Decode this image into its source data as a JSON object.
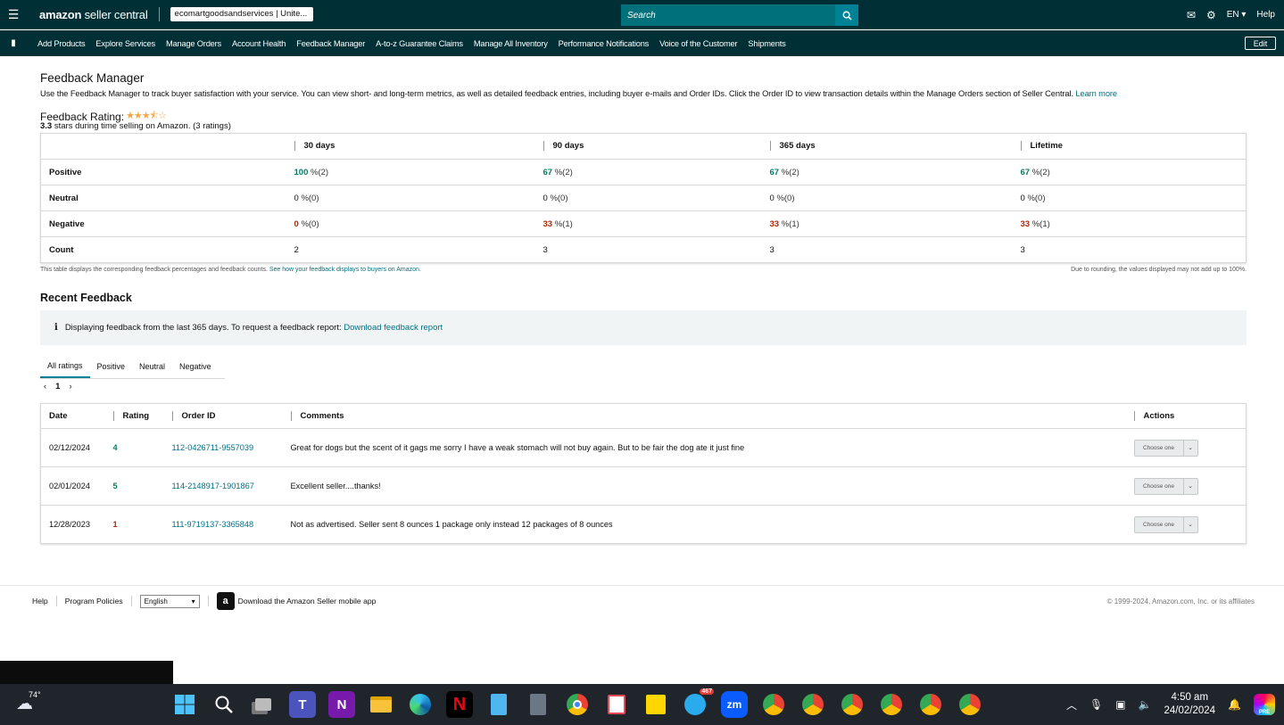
{
  "topbar": {
    "logo_brand": "amazon",
    "logo_suffix": "seller central",
    "store": "ecomartgoodsandservices | Unite...",
    "search_placeholder": "Search",
    "language": "EN",
    "help": "Help"
  },
  "nav": {
    "items": [
      "Add Products",
      "Explore Services",
      "Manage Orders",
      "Account Health",
      "Feedback Manager",
      "A-to-z Guarantee Claims",
      "Manage All Inventory",
      "Performance Notifications",
      "Voice of the Customer",
      "Shipments"
    ],
    "edit": "Edit"
  },
  "page": {
    "title": "Feedback Manager",
    "intro": "Use the Feedback Manager to track buyer satisfaction with your service. You can view short- and long-term metrics, as well as detailed feedback entries, including buyer e-mails and Order IDs. Click the Order ID to view transaction details within the Manage Orders section of Seller Central.",
    "learn_more": "Learn more",
    "rating_label": "Feedback Rating:",
    "rating_value": 3.3,
    "rating_stars": "3.3",
    "rating_sub_text": "stars during time selling on Amazon. (3 ratings)"
  },
  "metrics": {
    "columns": [
      "30 days",
      "90 days",
      "365 days",
      "Lifetime"
    ],
    "rows": [
      {
        "label": "Positive",
        "cells": [
          {
            "v": "100",
            "s": "%(2)"
          },
          {
            "v": "67",
            "s": "%(2)"
          },
          {
            "v": "67",
            "s": "%(2)"
          },
          {
            "v": "67",
            "s": "%(2)"
          }
        ]
      },
      {
        "label": "Neutral",
        "cells": [
          {
            "v": "0",
            "s": "%(0)"
          },
          {
            "v": "0",
            "s": "%(0)"
          },
          {
            "v": "0",
            "s": "%(0)"
          },
          {
            "v": "0",
            "s": "%(0)"
          }
        ]
      },
      {
        "label": "Negative",
        "cells": [
          {
            "v": "0",
            "s": "%(0)"
          },
          {
            "v": "33",
            "s": "%(1)"
          },
          {
            "v": "33",
            "s": "%(1)"
          },
          {
            "v": "33",
            "s": "%(1)"
          }
        ]
      },
      {
        "label": "Count",
        "cells": [
          {
            "v": "2",
            "s": ""
          },
          {
            "v": "3",
            "s": ""
          },
          {
            "v": "3",
            "s": ""
          },
          {
            "v": "3",
            "s": ""
          }
        ]
      }
    ],
    "note_left": "This table displays the corresponding feedback percentages and feedback counts.",
    "note_link": "See how your feedback displays to buyers on Amazon.",
    "note_right": "Due to rounding, the values displayed may not add up to 100%."
  },
  "recent": {
    "title": "Recent Feedback",
    "info_icon": "i",
    "info_text": "Displaying feedback from the last 365 days. To request a feedback report:",
    "info_link": "Download feedback report",
    "tabs": [
      "All ratings",
      "Positive",
      "Neutral",
      "Negative"
    ],
    "page": "1",
    "headers": [
      "Date",
      "Rating",
      "Order ID",
      "Comments",
      "Actions"
    ],
    "rows": [
      {
        "date": "02/12/2024",
        "rating": "4",
        "order": "112-0426711-9557039",
        "comment": "Great for dogs but the scent of it gags me sorry I have a weak stomach will not buy again. But to be fair the dog ate it just fine",
        "action": "Choose one"
      },
      {
        "date": "02/01/2024",
        "rating": "5",
        "order": "114-2148917-1901867",
        "comment": "Excellent seller....thanks!",
        "action": "Choose one"
      },
      {
        "date": "12/28/2023",
        "rating": "1",
        "order": "111-9719137-3365848",
        "comment": "Not as advertised. Seller sent 8 ounces 1 package only instead 12 packages of 8 ounces",
        "action": "Choose one"
      }
    ]
  },
  "footer": {
    "help": "Help",
    "policies": "Program Policies",
    "language": "English",
    "app": "Download the Amazon Seller mobile app",
    "app_icon": "a",
    "copyright": "© 1999-2024, Amazon.com, Inc. or its affiliates"
  },
  "taskbar": {
    "temp": "74°",
    "time": "4:50 am",
    "date": "24/02/2024",
    "telegram_badge": "467",
    "icon_labels": {
      "teams": "T",
      "onenote": "N",
      "netflix": "N",
      "zoom": "zm",
      "copilot": "PRE"
    }
  },
  "colors": {
    "header": "#002f36",
    "link": "#007185",
    "positive": "#067d62",
    "negative": "#b12704",
    "taskbar": "#20242b"
  }
}
